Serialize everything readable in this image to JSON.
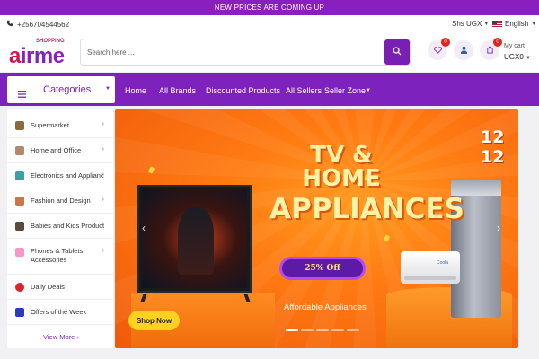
{
  "promo": {
    "text": "NEW PRICES ARE COMING UP"
  },
  "topbar": {
    "phone": "+256704544562",
    "currency": "Shs UGX",
    "language": "English"
  },
  "header": {
    "logo_small": "SHOPPING",
    "logo_prefix": "a",
    "logo_main": "irme",
    "search_placeholder": "Search here ...",
    "wishlist_count": "0",
    "cart_count": "0",
    "cart_label": "My cart",
    "cart_amount": "UGX0"
  },
  "nav": {
    "categories_label": "Categories",
    "links": [
      "Home",
      "All Brands",
      "Discounted Products",
      "All Sellers",
      "Seller Zone"
    ]
  },
  "sidebar": {
    "items": [
      {
        "label": "Supermarket",
        "color": "#8a6a3a"
      },
      {
        "label": "Home and Office",
        "color": "#b08a6a"
      },
      {
        "label": "Electronics and Appliances",
        "color": "#3aa0a8"
      },
      {
        "label": "Fashion and Design",
        "color": "#c8784a"
      },
      {
        "label": "Babies and Kids Products",
        "color": "#5a4a3a"
      },
      {
        "label": "Phones & Tablets Accessories",
        "color": "#f29ac5"
      },
      {
        "label": "Daily Deals",
        "color": "#d8242a"
      },
      {
        "label": "Offers of the Week",
        "color": "#2a3ab8"
      }
    ],
    "view_more": "View More"
  },
  "banner": {
    "title_line1": "TV & HOME",
    "title_line2": "APPLIANCES",
    "sale_badge": "12 12",
    "discount": "25% Off",
    "subtitle": "Affordable Appliances",
    "cta": "Shop Now",
    "ac_brand": "Coola",
    "slides_total": 5,
    "active_slide": 1
  },
  "colors": {
    "brand_purple": "#7d22bd",
    "promo_purple": "#8a1fbf",
    "banner_orange": "#ff7a12"
  }
}
